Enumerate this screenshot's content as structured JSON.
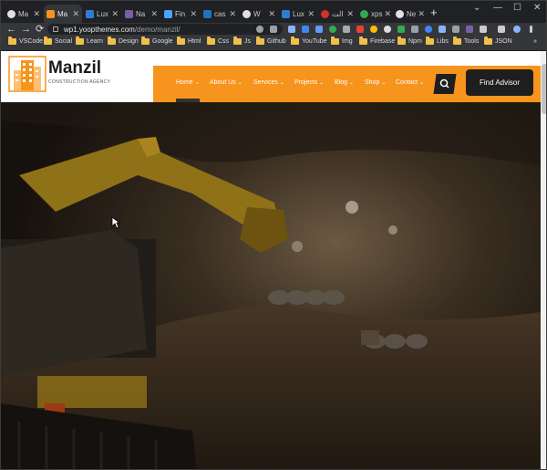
{
  "browser": {
    "tabs": [
      {
        "label": "Ma",
        "color": "#e0e0e0"
      },
      {
        "label": "Ma",
        "color": "#f7941d",
        "active": true
      },
      {
        "label": "Lux",
        "color": "#2d7dd2"
      },
      {
        "label": "Na",
        "color": "#7b5ea7"
      },
      {
        "label": "Fin",
        "color": "#4aa3ff"
      },
      {
        "label": "cas",
        "color": "#1e73be"
      },
      {
        "label": "W",
        "color": "#e0e0e0"
      },
      {
        "label": "Lux",
        "color": "#2d7dd2"
      },
      {
        "label": "الت",
        "color": "#d93025"
      },
      {
        "label": "xps",
        "color": "#34a853"
      },
      {
        "label": "Ne",
        "color": "#e0e0e0"
      }
    ],
    "new_tab": "+",
    "window_controls": [
      "⌄",
      "—",
      "☐",
      "✕"
    ],
    "nav": {
      "back": "←",
      "forward": "→",
      "reload": "⟳"
    },
    "url_domain": "wp1.yoopthemes.com",
    "url_path": "/demo/manzil/",
    "bookmarks": [
      "VSCode",
      "Social",
      "Learn",
      "Design",
      "Google",
      "Html",
      "Css",
      "Js",
      "Github",
      "YouTube",
      "Img",
      "Firebase",
      "Npm",
      "Libs",
      "Tools",
      "JSON"
    ],
    "bookmarks_more": "»"
  },
  "site": {
    "logo_name": "Manzil",
    "logo_tagline": "CONSTRUCTION AGENCY",
    "nav_items": [
      {
        "label": "Home",
        "active": true
      },
      {
        "label": "About Us",
        "active": false
      },
      {
        "label": "Services",
        "active": false
      },
      {
        "label": "Projects",
        "active": false
      },
      {
        "label": "Blog",
        "active": false
      },
      {
        "label": "Shop",
        "active": false
      },
      {
        "label": "Contact",
        "active": false
      }
    ],
    "search_icon": "search-icon",
    "cta_label": "Find Advisor",
    "accent_color": "#f7941d",
    "dark_color": "#1e1e1e"
  }
}
